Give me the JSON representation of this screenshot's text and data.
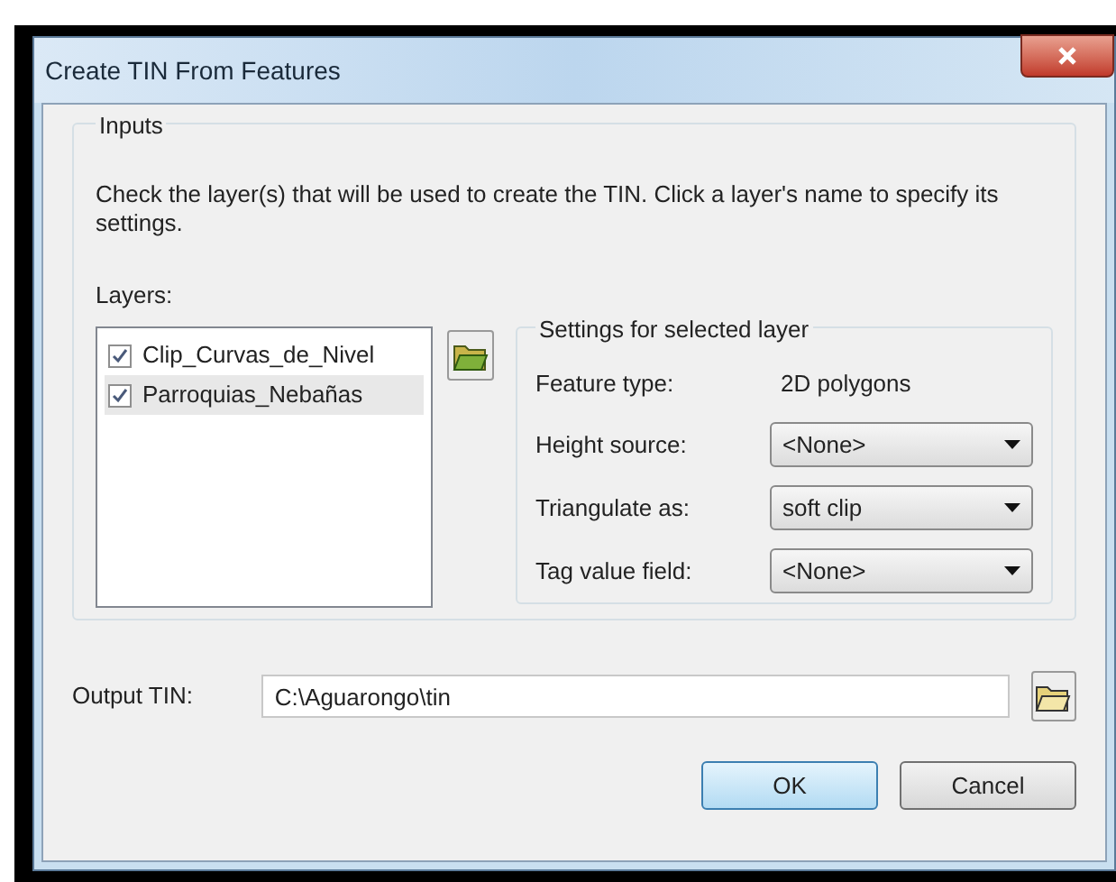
{
  "window": {
    "title": "Create TIN From Features"
  },
  "inputs": {
    "title": "Inputs",
    "description": "Check the layer(s) that will be used to create the TIN. Click a layer's name to specify its settings.",
    "layers_label": "Layers:",
    "layers": [
      {
        "name": "Clip_Curvas_de_Nivel",
        "checked": true,
        "selected": false
      },
      {
        "name": "Parroquias_Nebañas",
        "checked": true,
        "selected": true
      }
    ],
    "settings": {
      "title": "Settings for selected layer",
      "feature_type_label": "Feature type:",
      "feature_type": "2D polygons",
      "fields": [
        {
          "label": "Height source:",
          "value": "<None>"
        },
        {
          "label": "Triangulate as:",
          "value": "soft clip"
        },
        {
          "label": "Tag value field:",
          "value": "<None>"
        }
      ]
    }
  },
  "output": {
    "label": "Output TIN:",
    "value": "C:\\Aguarongo\\tin"
  },
  "buttons": [
    {
      "label": "OK",
      "default": true
    },
    {
      "label": "Cancel",
      "default": false
    }
  ]
}
